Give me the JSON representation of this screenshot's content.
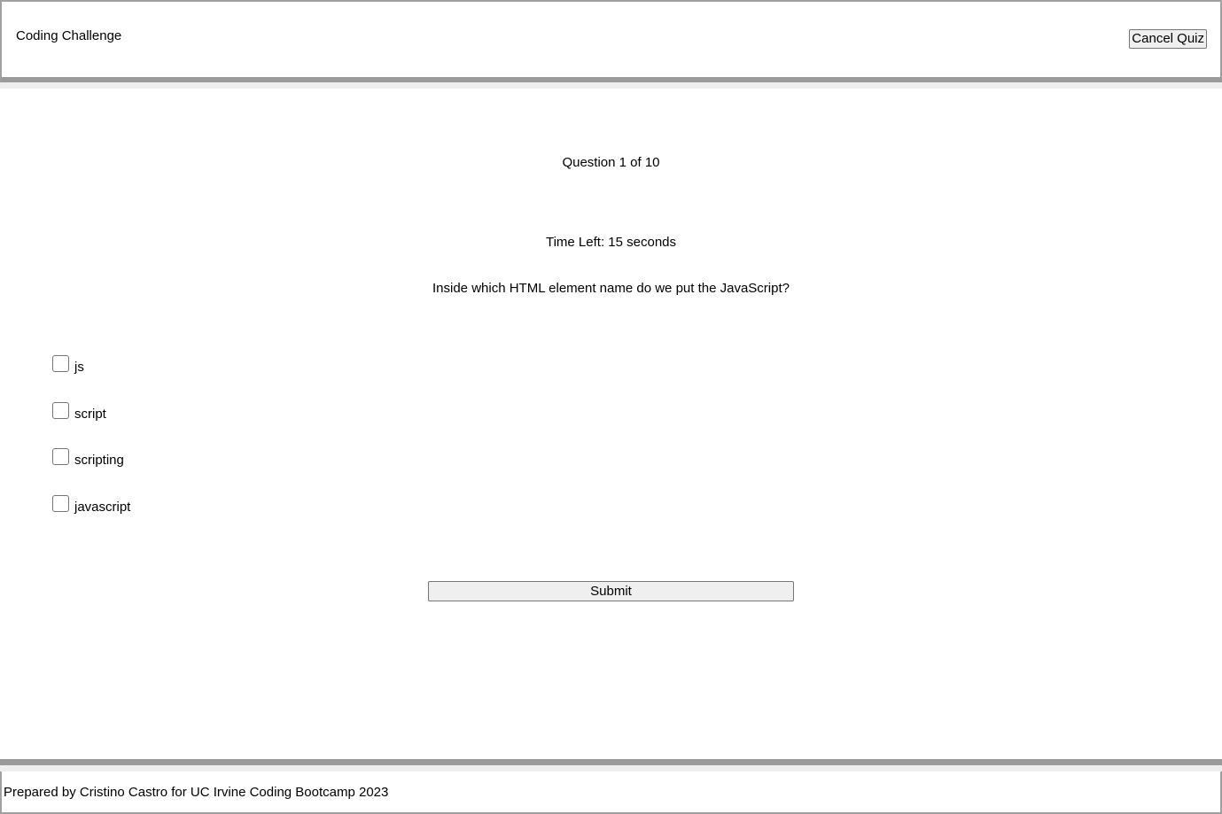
{
  "header": {
    "title": "Coding Challenge",
    "cancel_label": "Cancel Quiz"
  },
  "quiz": {
    "progress_text": "Question 1 of 10",
    "timer_text": "Time Left: 15 seconds",
    "question": "Inside which HTML element name do we put the JavaScript?",
    "options": [
      "js",
      "script",
      "scripting",
      "javascript"
    ],
    "submit_label": "Submit"
  },
  "footer": {
    "text": "Prepared by Cristino Castro for UC Irvine Coding Bootcamp 2023"
  }
}
